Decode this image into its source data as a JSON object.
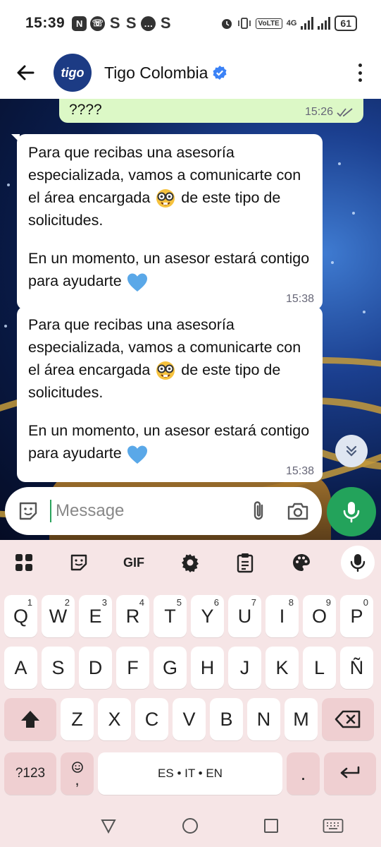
{
  "status_bar": {
    "time": "15:39",
    "notifications": [
      "N",
      "whatsapp",
      "S",
      "S",
      "chat",
      "S"
    ],
    "network_label": "VoLTE",
    "data_label": "4G",
    "battery": "61"
  },
  "header": {
    "avatar_text": "tigo",
    "contact_name": "Tigo Colombia",
    "verified": true
  },
  "messages": [
    {
      "direction": "outgoing",
      "text": "????",
      "time": "15:26",
      "status": "read-double-check"
    },
    {
      "direction": "incoming",
      "paragraph1_part1": "Para que recibas una asesoría especializada, vamos a comunicarte con el área encargada",
      "paragraph1_emoji": "nerd-face-emoji",
      "paragraph1_part2": "de este tipo de solicitudes.",
      "paragraph2_text": "En un momento, un asesor estará contigo para ayudarte",
      "paragraph2_emoji": "blue-heart-emoji",
      "time": "15:38"
    },
    {
      "direction": "incoming",
      "paragraph1_part1": "Para que recibas una asesoría especializada, vamos a comunicarte con el área encargada",
      "paragraph1_emoji": "nerd-face-emoji",
      "paragraph1_part2": "de este tipo de solicitudes.",
      "paragraph2_text": "En un momento, un asesor estará contigo para ayudarte",
      "paragraph2_emoji": "blue-heart-emoji",
      "time": "15:38"
    }
  ],
  "composer": {
    "placeholder": "Message"
  },
  "keyboard": {
    "toolbar": [
      "apps-icon",
      "sticker-icon",
      "GIF",
      "settings-icon",
      "clipboard-icon",
      "palette-icon",
      "mic-icon"
    ],
    "gif_label": "GIF",
    "row1": [
      {
        "key": "Q",
        "hint": "1"
      },
      {
        "key": "W",
        "hint": "2"
      },
      {
        "key": "E",
        "hint": "3"
      },
      {
        "key": "R",
        "hint": "4"
      },
      {
        "key": "T",
        "hint": "5"
      },
      {
        "key": "Y",
        "hint": "6"
      },
      {
        "key": "U",
        "hint": "7"
      },
      {
        "key": "I",
        "hint": "8"
      },
      {
        "key": "O",
        "hint": "9"
      },
      {
        "key": "P",
        "hint": "0"
      }
    ],
    "row2": [
      "A",
      "S",
      "D",
      "F",
      "G",
      "H",
      "J",
      "K",
      "L",
      "Ñ"
    ],
    "row3": [
      "Z",
      "X",
      "C",
      "V",
      "B",
      "N",
      "M"
    ],
    "symbols_label": "?123",
    "emoji_comma_label": ",",
    "space_label": "ES • IT • EN",
    "period_label": "."
  },
  "colors": {
    "outgoing_bubble": "#dcf8c6",
    "incoming_bubble": "#ffffff",
    "accent_green": "#23a35b",
    "verified_blue": "#3b82f6",
    "brand_navy": "#1c3b84",
    "keyboard_bg": "#f6e5e6",
    "special_key_bg": "#efcfd1"
  }
}
